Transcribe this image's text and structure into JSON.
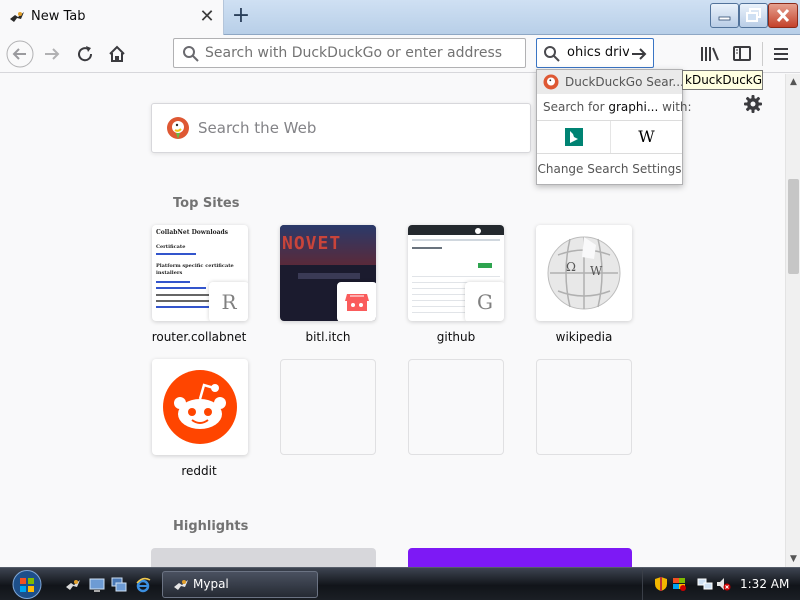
{
  "window": {
    "tab_title": "New Tab",
    "tab_close_glyph": "✕",
    "new_tab_glyph": "+"
  },
  "toolbar": {
    "urlbar_placeholder": "Search with DuckDuckGo or enter address",
    "searchbar_text": "ohics driv"
  },
  "page": {
    "web_search_placeholder": "Search the Web",
    "top_sites_title": "Top Sites",
    "highlights_title": "Highlights",
    "tiles": [
      {
        "label": "router.collabnet",
        "badge": "R"
      },
      {
        "label": "bitl.itch",
        "badge": ""
      },
      {
        "label": "github",
        "badge": "G"
      },
      {
        "label": "wikipedia",
        "badge": ""
      },
      {
        "label": "reddit",
        "badge": ""
      }
    ],
    "router_thumb": {
      "heading": "CollabNet Downloads",
      "sub": "Certificate",
      "section": "Platform specific certificate installers"
    },
    "bitl_thumb": {
      "banner": "NOVET"
    },
    "wiki_glyph": "W"
  },
  "search_popup": {
    "engine_label": "DuckDuckGo Sear...",
    "search_for_prefix": "Search for ",
    "search_for_query": "graphi...",
    "search_for_suffix": " with:",
    "wiki_glyph": "W",
    "change_settings": "Change Search Settings"
  },
  "tooltip": {
    "text": "kDuckDuckGo"
  },
  "taskbar": {
    "task_label": "Mypal",
    "clock": "1:32 AM"
  },
  "colors": {
    "ddg_orange": "#de5833",
    "reddit_orange": "#ff4500",
    "bing_teal": "#008373",
    "highlight_purple": "#7d19f5",
    "accent_blue": "#3a75c4"
  }
}
